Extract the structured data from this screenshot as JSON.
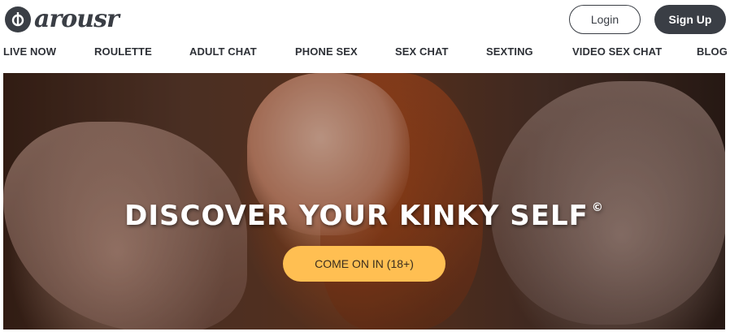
{
  "header": {
    "logo_text": "arousr",
    "login_label": "Login",
    "signup_label": "Sign Up"
  },
  "nav": {
    "items": [
      {
        "label": "LIVE NOW"
      },
      {
        "label": "ROULETTE"
      },
      {
        "label": "ADULT CHAT"
      },
      {
        "label": "PHONE SEX"
      },
      {
        "label": "SEX CHAT"
      },
      {
        "label": "SEXTING"
      },
      {
        "label": "VIDEO SEX CHAT"
      },
      {
        "label": "BLOG"
      }
    ]
  },
  "hero": {
    "title": "DISCOVER YOUR KINKY SELF",
    "title_mark": "©",
    "cta_label": "COME ON IN (18+)"
  },
  "colors": {
    "brand_dark": "#3a3e45",
    "cta": "#ffbf52"
  }
}
